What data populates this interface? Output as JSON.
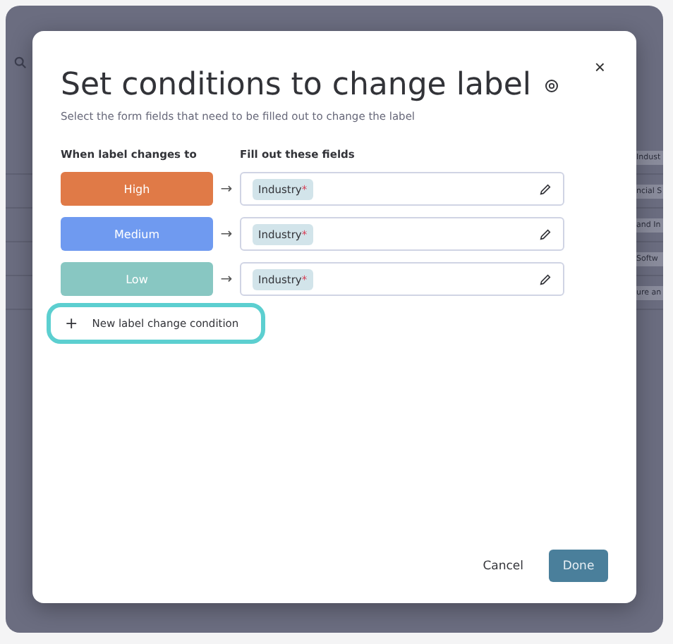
{
  "background": {
    "cells": [
      "Indust",
      "ncial S",
      "and In",
      "Softw",
      "ure an"
    ]
  },
  "dialog": {
    "title": "Set conditions to change label",
    "subtitle": "Select the form fields that need to be filled out to change the label",
    "column_headers": [
      "When label changes to",
      "Fill out these fields"
    ],
    "conditions": [
      {
        "label": "High",
        "color": "#e07a47",
        "arrow": "→",
        "field": "Industry",
        "required": "*"
      },
      {
        "label": "Medium",
        "color": "#6f9af0",
        "arrow": "→",
        "field": "Industry",
        "required": "*"
      },
      {
        "label": "Low",
        "color": "#88c7c2",
        "arrow": "→",
        "field": "Industry",
        "required": "*"
      }
    ],
    "add_button": {
      "icon": "+",
      "label": "New label change condition"
    },
    "close": "×",
    "buttons": [
      "Cancel",
      "Done"
    ]
  }
}
